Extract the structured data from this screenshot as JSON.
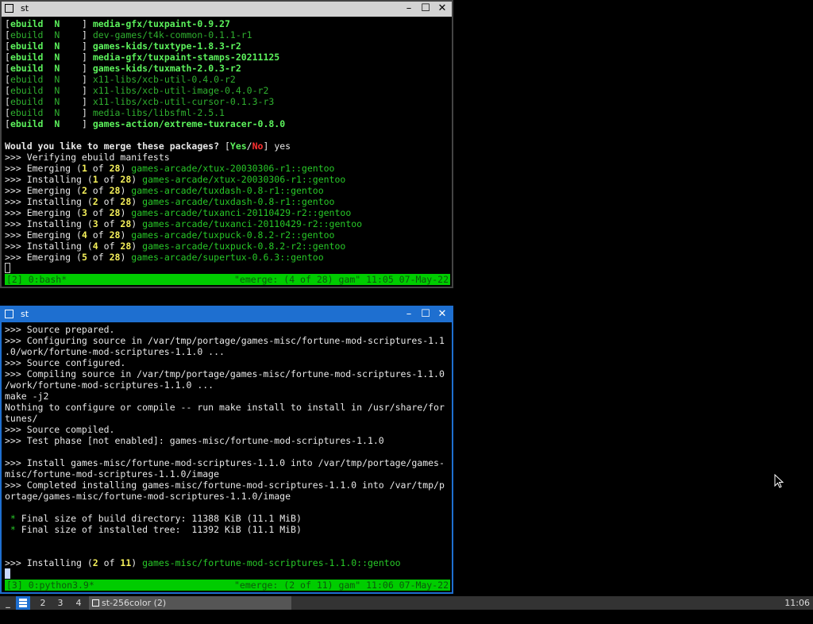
{
  "windows": {
    "top": {
      "title": "st",
      "buttons": {
        "minimize": "–",
        "maximize": "☐",
        "close": "✕"
      },
      "lines": [
        [
          {
            "t": "[",
            "c": "w"
          },
          {
            "t": "ebuild  N    ",
            "c": "gb"
          },
          {
            "t": "] ",
            "c": "w"
          },
          {
            "t": "media-gfx/tuxpaint-0.9.27",
            "c": "gb"
          }
        ],
        [
          {
            "t": "[",
            "c": "w"
          },
          {
            "t": "ebuild  N    ",
            "c": "gy"
          },
          {
            "t": "] ",
            "c": "w"
          },
          {
            "t": "dev-games/t4k-common-0.1.1-r1",
            "c": "gy"
          }
        ],
        [
          {
            "t": "[",
            "c": "w"
          },
          {
            "t": "ebuild  N    ",
            "c": "gb"
          },
          {
            "t": "] ",
            "c": "w"
          },
          {
            "t": "games-kids/tuxtype-1.8.3-r2",
            "c": "gb"
          }
        ],
        [
          {
            "t": "[",
            "c": "w"
          },
          {
            "t": "ebuild  N    ",
            "c": "gb"
          },
          {
            "t": "] ",
            "c": "w"
          },
          {
            "t": "media-gfx/tuxpaint-stamps-20211125",
            "c": "gb"
          }
        ],
        [
          {
            "t": "[",
            "c": "w"
          },
          {
            "t": "ebuild  N    ",
            "c": "gb"
          },
          {
            "t": "] ",
            "c": "w"
          },
          {
            "t": "games-kids/tuxmath-2.0.3-r2",
            "c": "gb"
          }
        ],
        [
          {
            "t": "[",
            "c": "w"
          },
          {
            "t": "ebuild  N    ",
            "c": "gy"
          },
          {
            "t": "] ",
            "c": "w"
          },
          {
            "t": "x11-libs/xcb-util-0.4.0-r2",
            "c": "gy"
          }
        ],
        [
          {
            "t": "[",
            "c": "w"
          },
          {
            "t": "ebuild  N    ",
            "c": "gy"
          },
          {
            "t": "] ",
            "c": "w"
          },
          {
            "t": "x11-libs/xcb-util-image-0.4.0-r2",
            "c": "gy"
          }
        ],
        [
          {
            "t": "[",
            "c": "w"
          },
          {
            "t": "ebuild  N    ",
            "c": "gy"
          },
          {
            "t": "] ",
            "c": "w"
          },
          {
            "t": "x11-libs/xcb-util-cursor-0.1.3-r3",
            "c": "gy"
          }
        ],
        [
          {
            "t": "[",
            "c": "w"
          },
          {
            "t": "ebuild  N    ",
            "c": "gy"
          },
          {
            "t": "] ",
            "c": "w"
          },
          {
            "t": "media-libs/libsfml-2.5.1",
            "c": "gy"
          }
        ],
        [
          {
            "t": "[",
            "c": "w"
          },
          {
            "t": "ebuild  N    ",
            "c": "gb"
          },
          {
            "t": "] ",
            "c": "w"
          },
          {
            "t": "games-action/extreme-tuxracer-0.8.0",
            "c": "gb"
          }
        ],
        [],
        [
          {
            "t": "Would you like to merge these packages? ",
            "c": "w b"
          },
          {
            "t": "[",
            "c": "w"
          },
          {
            "t": "Yes",
            "c": "gb"
          },
          {
            "t": "/",
            "c": "w"
          },
          {
            "t": "No",
            "c": "r"
          },
          {
            "t": "] yes",
            "c": "w"
          }
        ],
        [
          {
            "t": ">>> Verifying ebuild manifests",
            "c": "w"
          }
        ],
        [
          {
            "t": ">>> Emerging (",
            "c": "w"
          },
          {
            "t": "1",
            "c": "y"
          },
          {
            "t": " of ",
            "c": "w"
          },
          {
            "t": "28",
            "c": "y"
          },
          {
            "t": ") ",
            "c": "w"
          },
          {
            "t": "games-arcade/xtux-20030306-r1::gentoo",
            "c": "g"
          }
        ],
        [
          {
            "t": ">>> Installing (",
            "c": "w"
          },
          {
            "t": "1",
            "c": "y"
          },
          {
            "t": " of ",
            "c": "w"
          },
          {
            "t": "28",
            "c": "y"
          },
          {
            "t": ") ",
            "c": "w"
          },
          {
            "t": "games-arcade/xtux-20030306-r1::gentoo",
            "c": "g"
          }
        ],
        [
          {
            "t": ">>> Emerging (",
            "c": "w"
          },
          {
            "t": "2",
            "c": "y"
          },
          {
            "t": " of ",
            "c": "w"
          },
          {
            "t": "28",
            "c": "y"
          },
          {
            "t": ") ",
            "c": "w"
          },
          {
            "t": "games-arcade/tuxdash-0.8-r1::gentoo",
            "c": "g"
          }
        ],
        [
          {
            "t": ">>> Installing (",
            "c": "w"
          },
          {
            "t": "2",
            "c": "y"
          },
          {
            "t": " of ",
            "c": "w"
          },
          {
            "t": "28",
            "c": "y"
          },
          {
            "t": ") ",
            "c": "w"
          },
          {
            "t": "games-arcade/tuxdash-0.8-r1::gentoo",
            "c": "g"
          }
        ],
        [
          {
            "t": ">>> Emerging (",
            "c": "w"
          },
          {
            "t": "3",
            "c": "y"
          },
          {
            "t": " of ",
            "c": "w"
          },
          {
            "t": "28",
            "c": "y"
          },
          {
            "t": ") ",
            "c": "w"
          },
          {
            "t": "games-arcade/tuxanci-20110429-r2::gentoo",
            "c": "g"
          }
        ],
        [
          {
            "t": ">>> Installing (",
            "c": "w"
          },
          {
            "t": "3",
            "c": "y"
          },
          {
            "t": " of ",
            "c": "w"
          },
          {
            "t": "28",
            "c": "y"
          },
          {
            "t": ") ",
            "c": "w"
          },
          {
            "t": "games-arcade/tuxanci-20110429-r2::gentoo",
            "c": "g"
          }
        ],
        [
          {
            "t": ">>> Emerging (",
            "c": "w"
          },
          {
            "t": "4",
            "c": "y"
          },
          {
            "t": " of ",
            "c": "w"
          },
          {
            "t": "28",
            "c": "y"
          },
          {
            "t": ") ",
            "c": "w"
          },
          {
            "t": "games-arcade/tuxpuck-0.8.2-r2::gentoo",
            "c": "g"
          }
        ],
        [
          {
            "t": ">>> Installing (",
            "c": "w"
          },
          {
            "t": "4",
            "c": "y"
          },
          {
            "t": " of ",
            "c": "w"
          },
          {
            "t": "28",
            "c": "y"
          },
          {
            "t": ") ",
            "c": "w"
          },
          {
            "t": "games-arcade/tuxpuck-0.8.2-r2::gentoo",
            "c": "g"
          }
        ],
        [
          {
            "t": ">>> Emerging (",
            "c": "w"
          },
          {
            "t": "5",
            "c": "y"
          },
          {
            "t": " of ",
            "c": "w"
          },
          {
            "t": "28",
            "c": "y"
          },
          {
            "t": ") ",
            "c": "w"
          },
          {
            "t": "games-arcade/supertux-0.6.3::gentoo",
            "c": "g"
          }
        ]
      ],
      "status_left": "[2] 0:bash*",
      "status_right": "\"emerge: (4 of 28) gam\" 11:05 07-May-22"
    },
    "bottom": {
      "title": "st",
      "buttons": {
        "minimize": "–",
        "maximize": "☐",
        "close": "✕"
      },
      "lines": [
        [
          {
            "t": ">>> Source prepared.",
            "c": "w"
          }
        ],
        [
          {
            "t": ">>> Configuring source in /var/tmp/portage/games-misc/fortune-mod-scriptures-1.1",
            "c": "w"
          }
        ],
        [
          {
            "t": ".0/work/fortune-mod-scriptures-1.1.0 ...",
            "c": "w"
          }
        ],
        [
          {
            "t": ">>> Source configured.",
            "c": "w"
          }
        ],
        [
          {
            "t": ">>> Compiling source in /var/tmp/portage/games-misc/fortune-mod-scriptures-1.1.0",
            "c": "w"
          }
        ],
        [
          {
            "t": "/work/fortune-mod-scriptures-1.1.0 ...",
            "c": "w"
          }
        ],
        [
          {
            "t": "make -j2",
            "c": "w"
          }
        ],
        [
          {
            "t": "Nothing to configure or compile -- run make install to install in /usr/share/for",
            "c": "w"
          }
        ],
        [
          {
            "t": "tunes/",
            "c": "w"
          }
        ],
        [
          {
            "t": ">>> Source compiled.",
            "c": "w"
          }
        ],
        [
          {
            "t": ">>> Test phase [not enabled]: games-misc/fortune-mod-scriptures-1.1.0",
            "c": "w"
          }
        ],
        [],
        [
          {
            "t": ">>> Install games-misc/fortune-mod-scriptures-1.1.0 into /var/tmp/portage/games-",
            "c": "w"
          }
        ],
        [
          {
            "t": "misc/fortune-mod-scriptures-1.1.0/image",
            "c": "w"
          }
        ],
        [
          {
            "t": ">>> Completed installing games-misc/fortune-mod-scriptures-1.1.0 into /var/tmp/p",
            "c": "w"
          }
        ],
        [
          {
            "t": "ortage/games-misc/fortune-mod-scriptures-1.1.0/image",
            "c": "w"
          }
        ],
        [],
        [
          {
            "t": " * ",
            "c": "g"
          },
          {
            "t": "Final size of build directory: 11388 KiB (11.1 MiB)",
            "c": "w"
          }
        ],
        [
          {
            "t": " * ",
            "c": "g"
          },
          {
            "t": "Final size of installed tree:  11392 KiB (11.1 MiB)",
            "c": "w"
          }
        ],
        [],
        [],
        [
          {
            "t": ">>> Installing (",
            "c": "w"
          },
          {
            "t": "2",
            "c": "y"
          },
          {
            "t": " of ",
            "c": "w"
          },
          {
            "t": "11",
            "c": "y"
          },
          {
            "t": ") ",
            "c": "w"
          },
          {
            "t": "games-misc/fortune-mod-scriptures-1.1.0::gentoo",
            "c": "g"
          }
        ]
      ],
      "status_left": "[3] 0:python3.9*",
      "status_right": "\"emerge: (2 of 11) gam\" 11:06 07-May-22"
    }
  },
  "taskbar": {
    "workspaces": [
      "2",
      "3",
      "4"
    ],
    "task_label": "st-256color (2)",
    "clock": "11:06"
  },
  "colors": {
    "accent_blue": "#1e6fd0",
    "status_green": "#00cc00",
    "bright_green": "#5cf25c",
    "yellow": "#f5f05a",
    "red": "#ff3030"
  }
}
